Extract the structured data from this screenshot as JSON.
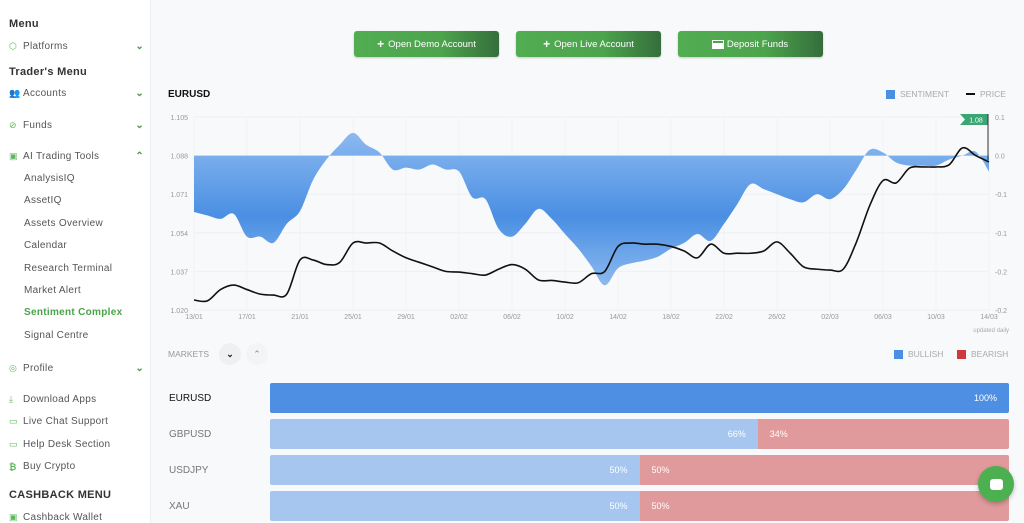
{
  "sidebar": {
    "menu_heading": "Menu",
    "platforms": "Platforms",
    "traders_heading": "Trader's Menu",
    "accounts": "Accounts",
    "funds": "Funds",
    "ai_tools": "AI Trading Tools",
    "ai_sub": [
      "AnalysisIQ",
      "AssetIQ",
      "Assets Overview",
      "Calendar",
      "Research Terminal",
      "Market Alert",
      "Sentiment Complex",
      "Signal Centre"
    ],
    "active_sub": "Sentiment Complex",
    "profile": "Profile",
    "download": "Download Apps",
    "live_chat": "Live Chat Support",
    "help_desk": "Help Desk Section",
    "buy_crypto": "Buy Crypto",
    "cashback_heading": "CASHBACK MENU",
    "cashback_wallet": "Cashback Wallet"
  },
  "actions": {
    "demo": "Open Demo Account",
    "live": "Open Live Account",
    "deposit": "Deposit Funds"
  },
  "chart_data": {
    "type": "area+line",
    "title": "EURUSD",
    "legend": [
      {
        "name": "SENTIMENT",
        "color": "#4a90e2"
      },
      {
        "name": "PRICE",
        "color": "#111111"
      }
    ],
    "legend_placement": "top-right",
    "x_ticks": [
      "13/01",
      "17/01",
      "21/01",
      "25/01",
      "29/01",
      "02/02",
      "06/02",
      "10/02",
      "14/02",
      "18/02",
      "22/02",
      "26/02",
      "02/03",
      "06/03",
      "10/03",
      "14/03"
    ],
    "left_ticks": [
      "1.105",
      "1.088",
      "1.071",
      "1.054",
      "1.037",
      "1.020"
    ],
    "left_ylim": [
      1.02,
      1.105
    ],
    "right_ticks": [
      "0.1",
      "0.0",
      "-0.1",
      "-0.1",
      "-0.2",
      "-0.2"
    ],
    "right_ylim": [
      -0.4,
      0.1
    ],
    "grid": true,
    "price_flag": "1.08",
    "footnote": "updated daily",
    "series": [
      {
        "name": "SENTIMENT",
        "values": [
          -0.146,
          -0.155,
          -0.164,
          -0.151,
          -0.21,
          -0.21,
          -0.226,
          -0.177,
          -0.144,
          -0.062,
          -0.01,
          0.028,
          0.059,
          0.028,
          0.008,
          -0.036,
          -0.031,
          -0.036,
          -0.023,
          -0.036,
          -0.041,
          -0.108,
          -0.113,
          -0.19,
          -0.21,
          -0.177,
          -0.138,
          -0.164,
          -0.203,
          -0.241,
          -0.287,
          -0.336,
          -0.292,
          -0.279,
          -0.272,
          -0.262,
          -0.241,
          -0.226,
          -0.203,
          -0.221,
          -0.177,
          -0.126,
          -0.074,
          -0.087,
          -0.1,
          -0.113,
          -0.121,
          -0.1,
          -0.113,
          -0.087,
          -0.036,
          0.015,
          0.008,
          -0.018,
          -0.026,
          -0.026,
          -0.026,
          -0.01,
          0,
          0.01,
          -0.041
        ]
      },
      {
        "name": "PRICE",
        "values": [
          1.0244,
          1.024,
          1.029,
          1.031,
          1.029,
          1.027,
          1.0266,
          1.027,
          1.042,
          1.042,
          1.04,
          1.041,
          1.0495,
          1.0495,
          1.0495,
          1.046,
          1.043,
          1.041,
          1.039,
          1.037,
          1.0367,
          1.036,
          1.0354,
          1.038,
          1.04,
          1.038,
          1.0332,
          1.033,
          1.0323,
          1.032,
          1.036,
          1.037,
          1.048,
          1.0495,
          1.049,
          1.049,
          1.048,
          1.046,
          1.043,
          1.049,
          1.045,
          1.045,
          1.045,
          1.046,
          1.05,
          1.045,
          1.039,
          1.038,
          1.0376,
          1.038,
          1.05,
          1.066,
          1.077,
          1.076,
          1.0825,
          1.083,
          1.083,
          1.084,
          1.0914,
          1.088,
          1.0852
        ]
      }
    ]
  },
  "markets": {
    "label": "MARKETS",
    "legend": {
      "bullish": "BULLISH",
      "bearish": "BEARISH",
      "bullish_color": "#4a90e2",
      "bearish_color": "#d0393b"
    },
    "rows": [
      {
        "name": "EURUSD",
        "bullish": 100,
        "bearish": 0,
        "bull_label": "100%",
        "bear_label": ""
      },
      {
        "name": "GBPUSD",
        "bullish": 66,
        "bearish": 34,
        "bull_label": "66%",
        "bear_label": "34%"
      },
      {
        "name": "USDJPY",
        "bullish": 50,
        "bearish": 50,
        "bull_label": "50%",
        "bear_label": "50%"
      },
      {
        "name": "XAU",
        "bullish": 50,
        "bearish": 50,
        "bull_label": "50%",
        "bear_label": "50%"
      }
    ]
  }
}
